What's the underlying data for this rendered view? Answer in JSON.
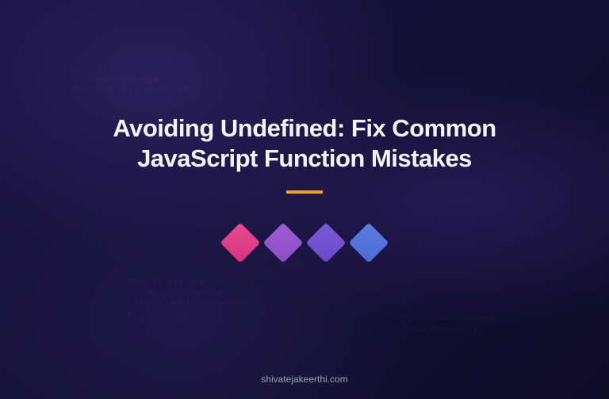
{
  "title": "Avoiding Undefined: Fix Common JavaScript Function Mistakes",
  "footer": "shivatejakeerthi.com",
  "diamonds": {
    "colors": [
      "#e94b8a",
      "#9d5dd4",
      "#7a5cd6",
      "#5b7de0"
    ]
  },
  "accent_color": "#f5a623"
}
